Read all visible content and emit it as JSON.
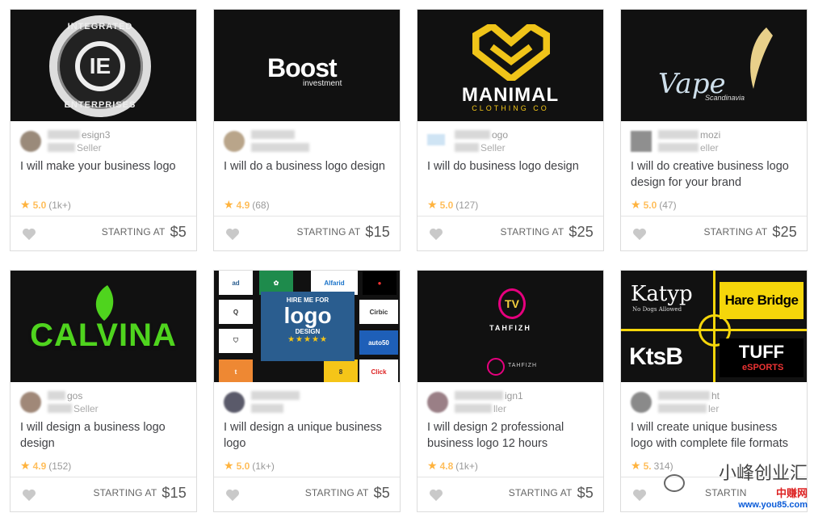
{
  "cards": [
    {
      "logo": {
        "top": "INTEGRATED",
        "bottom": "ENTERPRISES",
        "mono": "IE"
      },
      "seller_name_visible": "esign3",
      "seller_level_visible": "Seller",
      "title": "I will make your business logo",
      "rating": "5.0",
      "reviews": "(1k+)",
      "starting_label": "STARTING AT",
      "price": "$5"
    },
    {
      "logo": {
        "main": "Boost",
        "sub": "investment"
      },
      "seller_name_visible": "",
      "seller_level_visible": "",
      "title": "I will do a business logo design",
      "rating": "4.9",
      "reviews": "(68)",
      "starting_label": "STARTING AT",
      "price": "$15"
    },
    {
      "logo": {
        "main": "MANIMAL",
        "sub": "CLOTHING CO"
      },
      "seller_name_visible": "ogo",
      "seller_level_visible": "Seller",
      "title": "I will do business logo design",
      "rating": "5.0",
      "reviews": "(127)",
      "starting_label": "STARTING AT",
      "price": "$25"
    },
    {
      "logo": {
        "main": "Vape",
        "sub": "Scandinavia"
      },
      "seller_name_visible": "mozi",
      "seller_level_visible": "eller",
      "title": "I will do creative business logo design for your brand",
      "rating": "5.0",
      "reviews": "(47)",
      "starting_label": "STARTING AT",
      "price": "$25"
    },
    {
      "logo": {
        "main": "CALVINA"
      },
      "seller_name_visible": "gos",
      "seller_level_visible": "Seller",
      "title": "I will design a business logo design",
      "rating": "4.9",
      "reviews": "(152)",
      "starting_label": "STARTING AT",
      "price": "$15"
    },
    {
      "logo": {
        "line1": "HIRE ME FOR",
        "main": "logo",
        "line3": "DESIGN",
        "stars": "★★★★★",
        "minis": [
          "Alfarid",
          "Cirbic",
          "Click",
          "auto50"
        ]
      },
      "seller_name_visible": "",
      "seller_level_visible": "",
      "title": "I will design a unique business logo",
      "rating": "5.0",
      "reviews": "(1k+)",
      "starting_label": "STARTING AT",
      "price": "$5"
    },
    {
      "logo": {
        "main": "TAHFIZH",
        "mark": "TV",
        "small": "TAHFIZH"
      },
      "seller_name_visible": "ign1",
      "seller_level_visible": "ller",
      "title": "I will design 2 professional business logo 12 hours",
      "rating": "4.8",
      "reviews": "(1k+)",
      "starting_label": "STARTING AT",
      "price": "$5"
    },
    {
      "logo": {
        "katyp": "Katyp",
        "katyp_sub": "No Dogs Allowed",
        "harebridge": "Hare Bridge",
        "kts": "KtsB",
        "tuff": "TUFF",
        "esports": "eSPORTS"
      },
      "seller_name_visible": "ht",
      "seller_level_visible": "ler",
      "title": "I will create unique business logo with complete file formats",
      "rating": "5.",
      "reviews": "314)",
      "starting_label": "STARTIN",
      "price": ""
    }
  ],
  "watermark": {
    "brand": "小峰创业汇",
    "badge": "中赚网",
    "url": "www.you85.com"
  },
  "colors": {
    "star": "#ffb33e",
    "rating": "#ffbe5b",
    "heart": "#c9c9c9"
  }
}
